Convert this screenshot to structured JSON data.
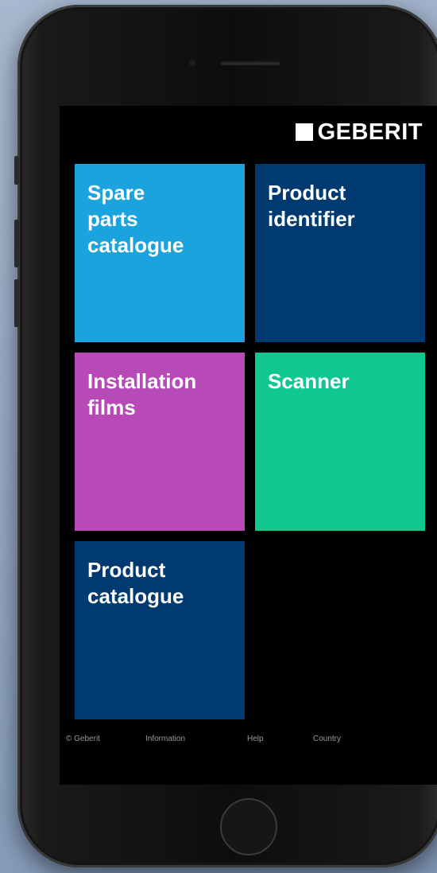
{
  "brand": {
    "name": "GEBERIT"
  },
  "tiles": [
    {
      "label": "Spare\nparts\ncatalogue",
      "color": "#1aa3dc"
    },
    {
      "label": "Product\nidentifier",
      "color": "#003a70"
    },
    {
      "label": "Installation\nfilms",
      "color": "#b84ab7"
    },
    {
      "label": "Scanner",
      "color": "#0fc78f"
    },
    {
      "label": "Product\ncatalogue",
      "color": "#003a70"
    }
  ],
  "footer": {
    "copyright": "© Geberit",
    "information": "Information",
    "help": "Help",
    "country": "Country"
  }
}
